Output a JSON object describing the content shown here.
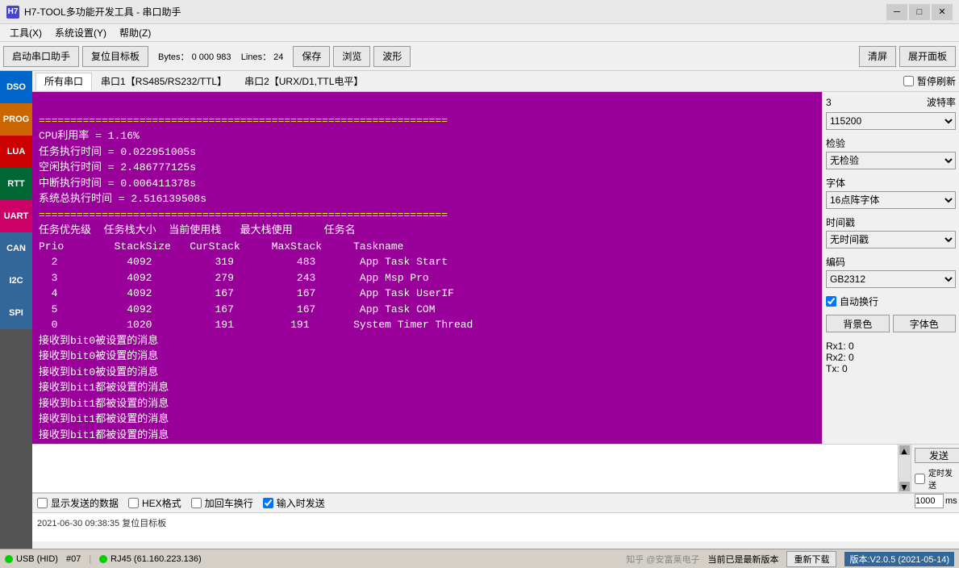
{
  "titlebar": {
    "icon": "H7",
    "title": "H7-TOOL多功能开发工具 - 串口助手",
    "minimize": "─",
    "maximize": "□",
    "close": "✕"
  },
  "menubar": {
    "items": [
      "工具(X)",
      "系统设置(Y)",
      "帮助(Z)"
    ]
  },
  "toolbar": {
    "start_btn": "启动串口助手",
    "reset_btn": "复位目标板",
    "bytes_label": "Bytes：",
    "bytes_value": "0 000 983",
    "lines_label": "Lines：",
    "lines_value": "24",
    "save_btn": "保存",
    "browse_btn": "浏览",
    "wave_btn": "波形",
    "clear_btn": "清屏",
    "expand_btn": "展开面板"
  },
  "tabs": {
    "items": [
      "所有串口",
      "串口1【RS485/RS232/TTL】",
      "串口2【URX/D1,TTL电平】"
    ],
    "active": 0,
    "pause_label": "暂停刷新"
  },
  "sidebar": {
    "items": [
      "DSO",
      "PROG",
      "LUA",
      "RTT",
      "UART",
      "CAN",
      "I2C",
      "SPI"
    ]
  },
  "terminal": {
    "divider1": "=================================================================",
    "cpu_line": "CPU利用率 = 1.16%",
    "task_time": "任务执行时间 = 0.022951005s",
    "idle_time": "空闲执行时间 = 2.486777125s",
    "irq_time": "中断执行时间 = 0.006411378s",
    "total_time": "系统总执行时间 = 2.516139508s",
    "divider2": "=================================================================",
    "table_header1": "任务优先级  任务栈大小  当前使用栈   最大栈使用     任务名",
    "table_header2": "Prio        StackSize   CurStack     MaxStack     Taskname",
    "rows": [
      {
        "prio": "2",
        "stacksize": "4092",
        "curstack": "319",
        "maxstack": "483",
        "taskname": "App Task Start"
      },
      {
        "prio": "3",
        "stacksize": "4092",
        "curstack": "279",
        "maxstack": "243",
        "taskname": "App Msp Pro"
      },
      {
        "prio": "4",
        "stacksize": "4092",
        "curstack": "167",
        "maxstack": "167",
        "taskname": "App Task UserIF"
      },
      {
        "prio": "5",
        "stacksize": "4092",
        "curstack": "167",
        "maxstack": "167",
        "taskname": "App Task COM"
      },
      {
        "prio": "0",
        "stacksize": "1020",
        "curstack": "191",
        "maxstack": "191",
        "taskname": "System Timer Thread"
      }
    ],
    "messages": [
      "接收到bit0被设置的消息",
      "接收到bit0被设置的消息",
      "接收到bit0被设置的消息",
      "接收到bit1都被设置的消息",
      "接收到bit1都被设置的消息",
      "接收到bit1都被设置的消息",
      "接收到bit1都被设置的消息"
    ]
  },
  "right_panel": {
    "baud_label": "波特率",
    "baud_num": "3",
    "baud_options": [
      "115200"
    ],
    "baud_selected": "115200",
    "verify_label": "检验",
    "verify_options": [
      "无检验"
    ],
    "verify_selected": "无检验",
    "font_label": "字体",
    "font_options": [
      "16点阵字体"
    ],
    "font_selected": "16点阵字体",
    "time_label": "时间戳",
    "time_options": [
      "无时间戳"
    ],
    "time_selected": "无时间戳",
    "encoding_label": "编码",
    "encoding_options": [
      "GB2312"
    ],
    "encoding_selected": "GB2312",
    "auto_run_label": "自动换行",
    "bg_color_btn": "背景色",
    "font_color_btn": "字体色",
    "rx1_label": "Rx1:",
    "rx1_value": "0",
    "rx2_label": "Rx2:",
    "rx2_value": "0",
    "tx_label": "Tx:",
    "tx_value": "0"
  },
  "bottom": {
    "send_btn": "发送",
    "timed_send_label": "定时发送",
    "timed_send_value": "1000",
    "ms_label": "ms",
    "show_send_label": "显示发送的数据",
    "hex_label": "HEX格式",
    "add_crlf_label": "加回车换行",
    "send_on_input_label": "输入时发送",
    "log_text": "2021-06-30 09:38:35 复位目标板"
  },
  "statusbar": {
    "usb_label": "USB (HID)",
    "port_label": "#07",
    "ip_label": "RJ45 (61.160.223.136)",
    "status_msg": "当前已是最新版本",
    "redownload_btn": "重新下载",
    "version_label": "版本:V2.0.5 (2021-05-14)",
    "watermark": "知乎 @安富莱电子"
  }
}
